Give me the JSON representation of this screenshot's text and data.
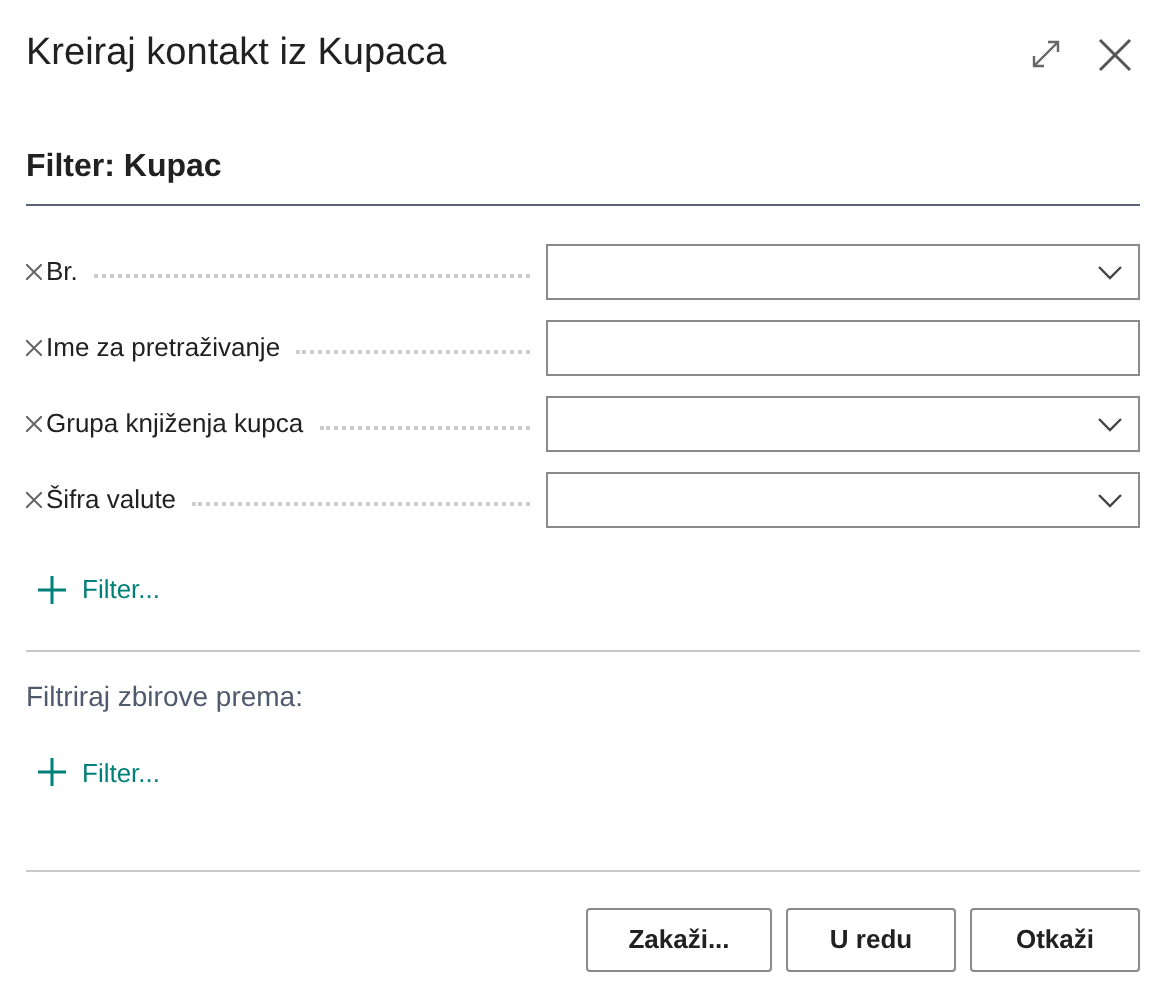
{
  "window": {
    "title": "Kreiraj kontakt iz Kupaca"
  },
  "filter_section": {
    "title": "Filter: Kupac",
    "fields": [
      {
        "label": "Br.",
        "kind": "dropdown"
      },
      {
        "label": "Ime za pretraživanje",
        "kind": "text"
      },
      {
        "label": "Grupa knjiženja kupca",
        "kind": "dropdown"
      },
      {
        "label": "Šifra valute",
        "kind": "dropdown"
      }
    ],
    "add_filter": "Filter..."
  },
  "totals_section": {
    "title": "Filtriraj zbirove prema:",
    "add_filter": "Filter..."
  },
  "buttons": [
    "Zakaži...",
    "U redu",
    "Otkaži"
  ]
}
